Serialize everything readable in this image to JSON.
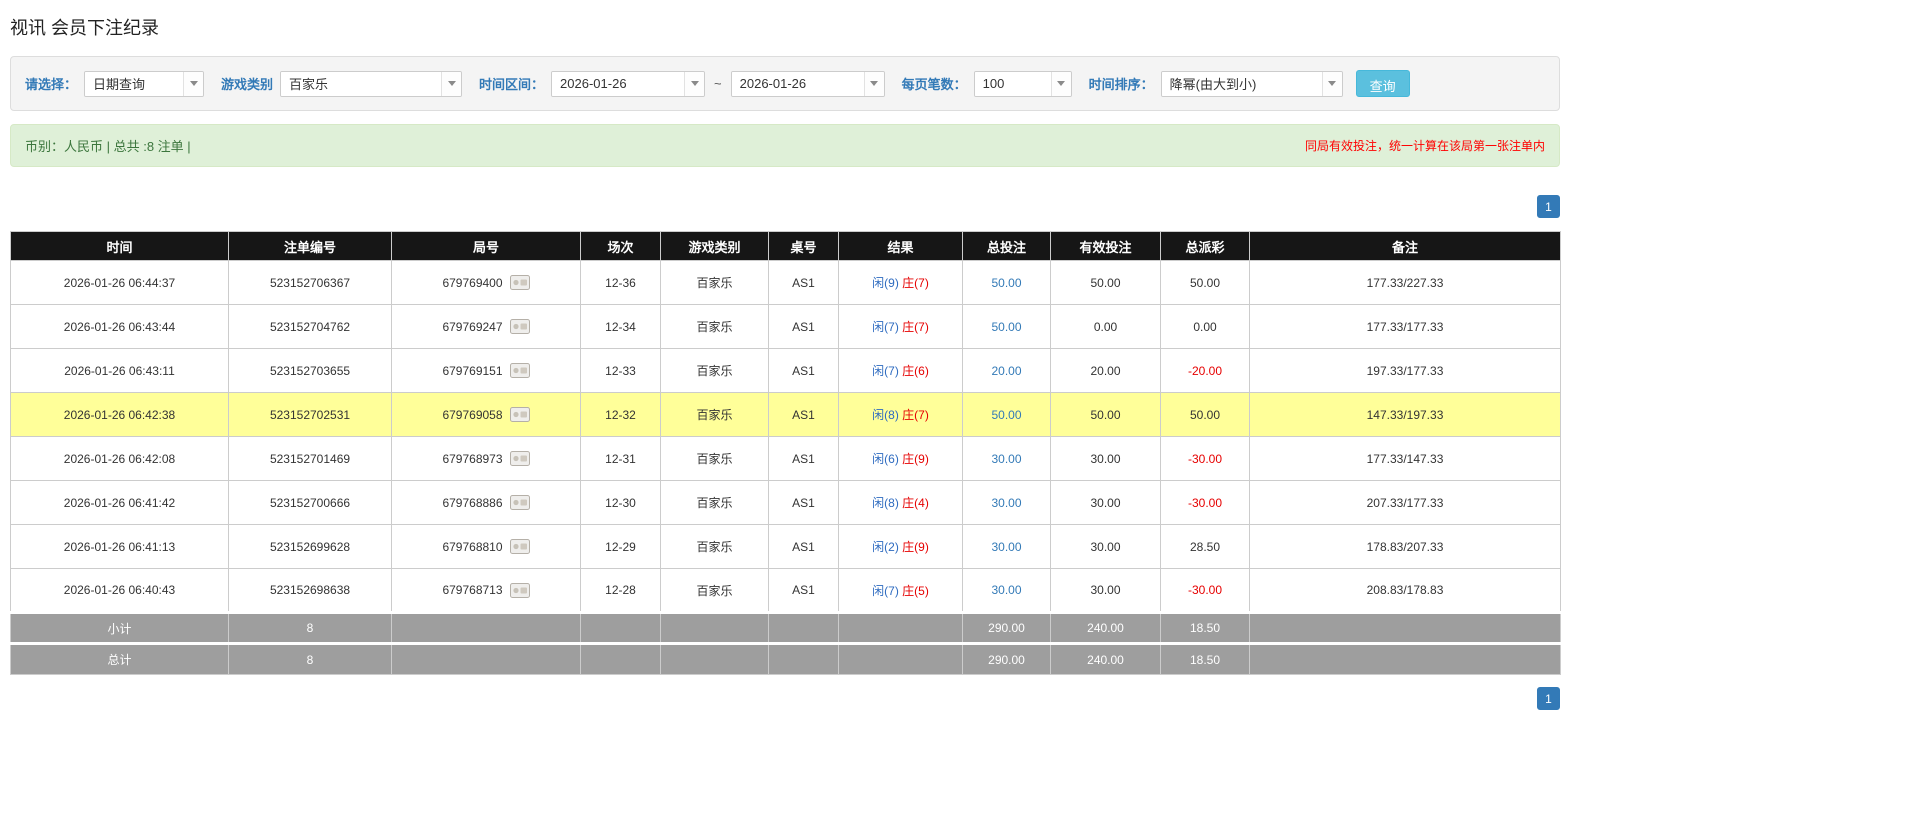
{
  "colors": {
    "label-blue": "#337ab7",
    "accent": "#5bc0de",
    "success-text": "#3c763d",
    "alert-red": "#ff0000",
    "pager-blue": "#337ab7",
    "link-blue": "#337ab7",
    "player-blue": "#2e6bc0",
    "banker-red": "#e60000",
    "highlight": "#ffff99",
    "foot-gray": "#9e9e9e"
  },
  "page": {
    "title": "视讯 会员下注纪录"
  },
  "filters": {
    "query_type_label": "请选择：",
    "query_type_value": "日期查询",
    "game_type_label": "游戏类别",
    "game_type_value": "百家乐",
    "time_range_label": "时间区间：",
    "date_from": "2026-01-26",
    "range_separator": "~",
    "date_to": "2026-01-26",
    "per_page_label": "每页笔数：",
    "per_page_value": "100",
    "sort_label": "时间排序：",
    "sort_value": "降幂(由大到小)",
    "search_button_label": "查询"
  },
  "summary": {
    "currency_info": "币别：人民币 | 总共 :8 注单 |",
    "notice": "同局有效投注，统一计算在该局第一张注单内"
  },
  "pagination": {
    "current_page": "1"
  },
  "table": {
    "headers": [
      "时间",
      "注单编号",
      "局号",
      "场次",
      "游戏类别",
      "桌号",
      "结果",
      "总投注",
      "有效投注",
      "总派彩",
      "备注"
    ],
    "rows": [
      {
        "time": "2026-01-26 06:44:37",
        "bet_id": "523152706367",
        "round_id": "679769400",
        "session": "12-36",
        "game": "百家乐",
        "table_no": "AS1",
        "result_player": "闲(9)",
        "result_banker": "庄(7)",
        "total_bet": "50.00",
        "valid_bet": "50.00",
        "payout": "50.00",
        "note": "177.33/227.33",
        "highlighted": false
      },
      {
        "time": "2026-01-26 06:43:44",
        "bet_id": "523152704762",
        "round_id": "679769247",
        "session": "12-34",
        "game": "百家乐",
        "table_no": "AS1",
        "result_player": "闲(7)",
        "result_banker": "庄(7)",
        "total_bet": "50.00",
        "valid_bet": "0.00",
        "payout": "0.00",
        "note": "177.33/177.33",
        "highlighted": false
      },
      {
        "time": "2026-01-26 06:43:11",
        "bet_id": "523152703655",
        "round_id": "679769151",
        "session": "12-33",
        "game": "百家乐",
        "table_no": "AS1",
        "result_player": "闲(7)",
        "result_banker": "庄(6)",
        "total_bet": "20.00",
        "valid_bet": "20.00",
        "payout": "-20.00",
        "note": "197.33/177.33",
        "highlighted": false
      },
      {
        "time": "2026-01-26 06:42:38",
        "bet_id": "523152702531",
        "round_id": "679769058",
        "session": "12-32",
        "game": "百家乐",
        "table_no": "AS1",
        "result_player": "闲(8)",
        "result_banker": "庄(7)",
        "total_bet": "50.00",
        "valid_bet": "50.00",
        "payout": "50.00",
        "note": "147.33/197.33",
        "highlighted": true
      },
      {
        "time": "2026-01-26 06:42:08",
        "bet_id": "523152701469",
        "round_id": "679768973",
        "session": "12-31",
        "game": "百家乐",
        "table_no": "AS1",
        "result_player": "闲(6)",
        "result_banker": "庄(9)",
        "total_bet": "30.00",
        "valid_bet": "30.00",
        "payout": "-30.00",
        "note": "177.33/147.33",
        "highlighted": false
      },
      {
        "time": "2026-01-26 06:41:42",
        "bet_id": "523152700666",
        "round_id": "679768886",
        "session": "12-30",
        "game": "百家乐",
        "table_no": "AS1",
        "result_player": "闲(8)",
        "result_banker": "庄(4)",
        "total_bet": "30.00",
        "valid_bet": "30.00",
        "payout": "-30.00",
        "note": "207.33/177.33",
        "highlighted": false
      },
      {
        "time": "2026-01-26 06:41:13",
        "bet_id": "523152699628",
        "round_id": "679768810",
        "session": "12-29",
        "game": "百家乐",
        "table_no": "AS1",
        "result_player": "闲(2)",
        "result_banker": "庄(9)",
        "total_bet": "30.00",
        "valid_bet": "30.00",
        "payout": "28.50",
        "note": "178.83/207.33",
        "highlighted": false
      },
      {
        "time": "2026-01-26 06:40:43",
        "bet_id": "523152698638",
        "round_id": "679768713",
        "session": "12-28",
        "game": "百家乐",
        "table_no": "AS1",
        "result_player": "闲(7)",
        "result_banker": "庄(5)",
        "total_bet": "30.00",
        "valid_bet": "30.00",
        "payout": "-30.00",
        "note": "208.83/178.83",
        "highlighted": false
      }
    ],
    "footer_rows": [
      {
        "label": "小计",
        "count": "8",
        "total_bet": "290.00",
        "valid_bet": "240.00",
        "payout": "18.50"
      },
      {
        "label": "总计",
        "count": "8",
        "total_bet": "290.00",
        "valid_bet": "240.00",
        "payout": "18.50"
      }
    ]
  }
}
